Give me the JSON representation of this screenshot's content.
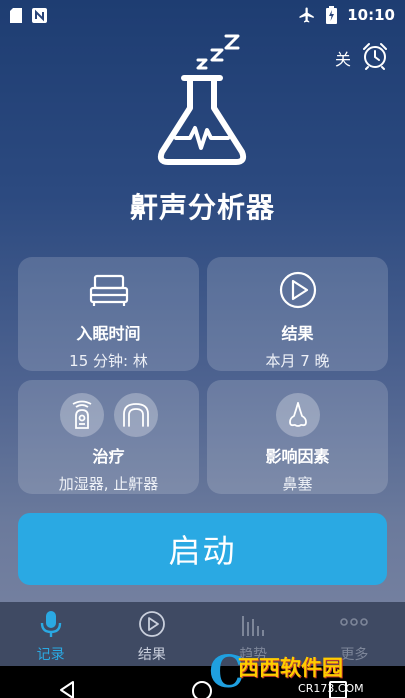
{
  "status_bar": {
    "time": "10:10",
    "left_icons": [
      "sd-card-icon",
      "n-notification-icon"
    ],
    "right_icons": [
      "airplane-icon",
      "battery-charging-icon"
    ]
  },
  "alarm": {
    "label": "关",
    "icon": "alarm-clock-icon"
  },
  "app": {
    "title": "鼾声分析器",
    "logo": "flask-zzz-icon"
  },
  "cards": {
    "sleep_time": {
      "title": "入眠时间",
      "subtitle": "15 分钟: 林",
      "icon": "bed-icon"
    },
    "results": {
      "title": "结果",
      "subtitle": "本月 7 晚",
      "icon": "play-circle-icon"
    },
    "remedies": {
      "title": "治疗",
      "subtitle": "加湿器, 止鼾器",
      "icons": [
        "humidifier-icon",
        "mouthguard-icon"
      ]
    },
    "factors": {
      "title": "影响因素",
      "subtitle": "鼻塞",
      "icon": "nose-icon"
    }
  },
  "start_button": {
    "label": "启动"
  },
  "tabs": [
    {
      "label": "记录",
      "icon": "microphone-icon",
      "active": true
    },
    {
      "label": "结果",
      "icon": "play-circle-icon",
      "active": false
    },
    {
      "label": "趋势",
      "icon": "bar-chart-icon",
      "active": false
    },
    {
      "label": "更多",
      "icon": "more-dots-icon",
      "active": false
    }
  ],
  "watermark": {
    "main": "西西软件园",
    "sub": "CR173.COM"
  },
  "colors": {
    "accent": "#2aa9e3",
    "tabbar": "#3f4a63",
    "card": "rgba(255,255,255,0.16)"
  }
}
